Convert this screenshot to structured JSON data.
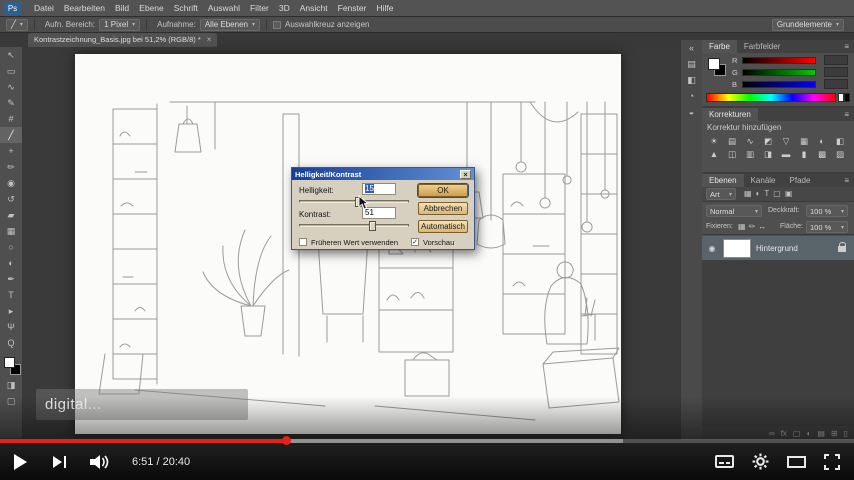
{
  "player": {
    "time_display": "6:51 / 20:40",
    "watermark_text": "digital...",
    "progress": {
      "played_percent": 33.5,
      "buffered_percent": 73
    },
    "colors": {
      "progress_red": "#e62117"
    }
  },
  "photoshop": {
    "menubar": {
      "logo": "Ps",
      "items": [
        "Datei",
        "Bearbeiten",
        "Bild",
        "Ebene",
        "Schrift",
        "Auswahl",
        "Filter",
        "3D",
        "Ansicht",
        "Fenster",
        "Hilfe"
      ]
    },
    "optionsbar": {
      "sample_size_label": "Aufn. Bereich:",
      "sample_size_value": "1 Pixel",
      "sample_label": "Aufnahme:",
      "sample_value": "Alle Ebenen",
      "show_ring_label": "Auswahlkreuz anzeigen",
      "workspace": "Grundelemente"
    },
    "tab": {
      "title": "Kontrastzeichnung_Basis.jpg bei 51,2% (RGB/8) *",
      "close": "×"
    },
    "tools": [
      "↖",
      "▭",
      "∿",
      "✎",
      "#",
      "╱",
      "+",
      "✏",
      "◉",
      "↺",
      "▰",
      "▦",
      "○",
      "◐",
      "✒",
      "T",
      "▸",
      "Ψ",
      "Q"
    ],
    "toolbar_bottom": [
      "◨",
      "▢"
    ],
    "panelstrip_icons": [
      "▤",
      "◧",
      "◔",
      "◒"
    ],
    "color_panel": {
      "tabs": [
        "Farbe",
        "Farbfelder"
      ],
      "channels": [
        "R",
        "G",
        "B"
      ]
    },
    "adjustments_panel": {
      "title": "Korrekturen",
      "subtitle": "Korrektur hinzufügen",
      "icons": [
        "☀",
        "▤",
        "∿",
        "◩",
        "▽",
        "▦",
        "◐",
        "◧",
        "▲",
        "◫",
        "▥",
        "◨",
        "▬",
        "▮",
        "▩",
        "▨"
      ]
    },
    "layers_panel": {
      "tabs": [
        "Ebenen",
        "Kanäle",
        "Pfade"
      ],
      "filter_label": "Art",
      "filter_icons": [
        "▦",
        "◐",
        "T",
        "▢",
        "▣"
      ],
      "blend_mode": "Normal",
      "opacity_label": "Deckkraft:",
      "opacity_value": "100 %",
      "lock_label": "Fixieren:",
      "lock_icons": [
        "▦",
        "✏",
        "↔"
      ],
      "fill_label": "Fläche:",
      "fill_value": "100 %",
      "layer_name": "Hintergrund",
      "bottom_icons": [
        "∞",
        "fx",
        "▢",
        "◐",
        "▤",
        "⊞",
        "▯"
      ]
    },
    "dialog": {
      "title": "Helligkeit/Kontrast",
      "close": "×",
      "brightness_label": "Helligkeit:",
      "brightness_value": "15",
      "contrast_label": "Kontrast:",
      "contrast_value": "51",
      "ok": "OK",
      "cancel": "Abbrechen",
      "auto": "Automatisch",
      "legacy_label": "Früheren Wert verwenden",
      "preview_label": "Vorschau"
    },
    "glyphs": {
      "caret": "▾",
      "menu": "≡",
      "eye": "◉",
      "collapse": "«",
      "check": "✓"
    }
  }
}
